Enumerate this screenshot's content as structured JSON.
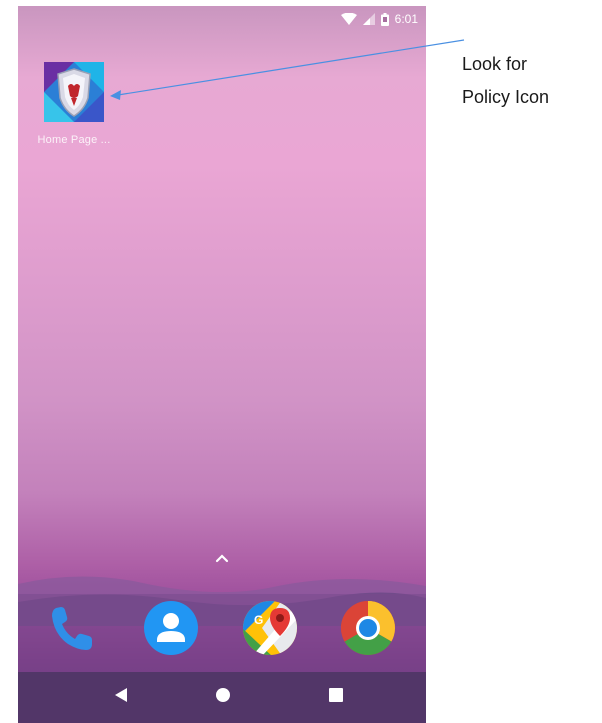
{
  "status_bar": {
    "time": "6:01",
    "wifi_icon": "wifi-icon",
    "signal_icon": "signal-icon",
    "battery_icon": "battery-icon"
  },
  "home_screen": {
    "app": {
      "label": "Home Page ...",
      "icon": "policy-shield-icon"
    }
  },
  "dock": {
    "apps": [
      {
        "icon": "phone-icon"
      },
      {
        "icon": "contacts-icon"
      },
      {
        "icon": "maps-icon"
      },
      {
        "icon": "chrome-icon"
      }
    ],
    "drawer_icon": "chevron-up-icon"
  },
  "nav_bar": {
    "back": "back-icon",
    "home": "home-icon",
    "recents": "recents-icon"
  },
  "annotation": {
    "line1": "Look for",
    "line2": "Policy Icon"
  },
  "colors": {
    "annotation_arrow": "#4a90e2",
    "nav_bar": "#523668"
  }
}
